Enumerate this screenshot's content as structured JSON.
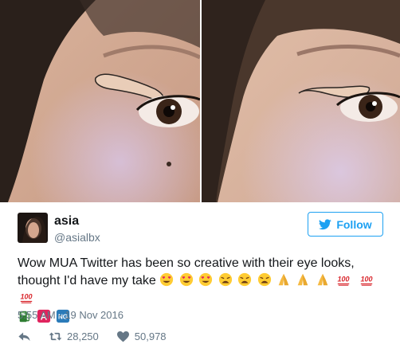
{
  "tweet": {
    "author_name": "asia",
    "author_handle": "@asialbx",
    "follow_label": "Follow",
    "text_line1": "Wow MUA Twitter has been so creative with their eye looks,",
    "text_line2": "thought I'd have my take",
    "timestamp": "5:55 AM - 19 Nov 2016",
    "retweets": "28,250",
    "likes": "50,978",
    "badge_a": "A",
    "badge_ng": "NG",
    "emoji_100": "100"
  },
  "colors": {
    "accent": "#1da1f2",
    "muted": "#657786",
    "text": "#14171a"
  },
  "icons": [
    "twitter-bird-icon",
    "reply-icon",
    "retweet-icon",
    "heart-icon"
  ]
}
